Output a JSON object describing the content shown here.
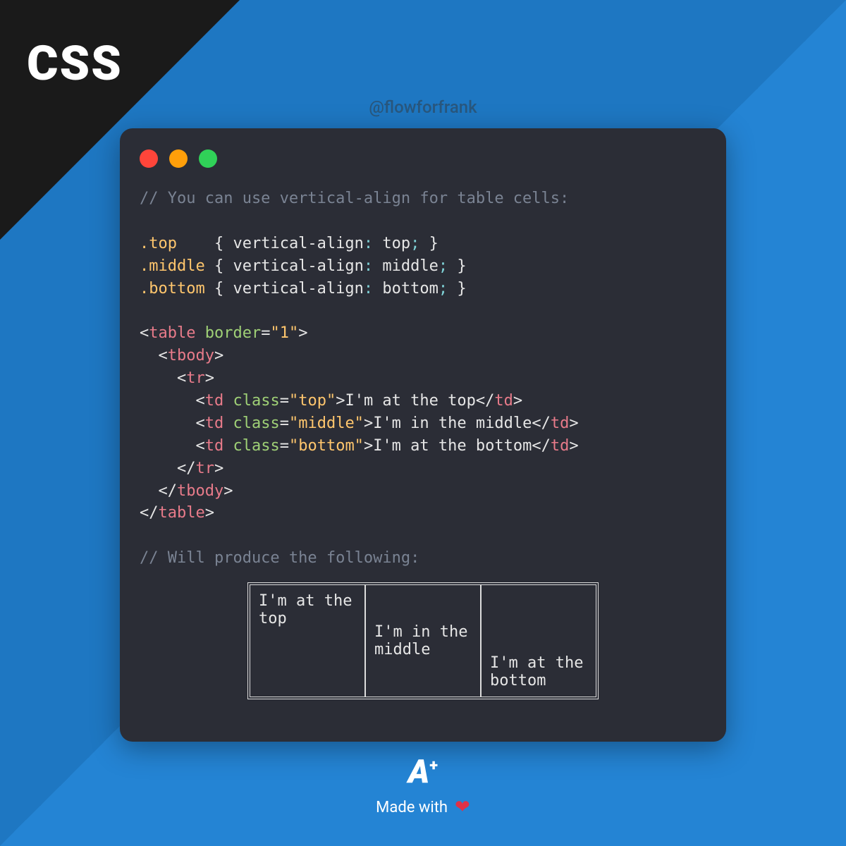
{
  "badge": "CSS",
  "handle": "@flowforfrank",
  "code": {
    "comment1": "// You can use vertical-align for table cells:",
    "sel1": ".top",
    "sel2": ".middle",
    "sel3": ".bottom",
    "prop": "vertical-align",
    "val1": "top",
    "val2": "middle",
    "val3": "bottom",
    "tag_table": "table",
    "attr_border": "border",
    "border_val": "\"1\"",
    "tag_tbody": "tbody",
    "tag_tr": "tr",
    "tag_td": "td",
    "attr_class": "class",
    "cls_top": "\"top\"",
    "cls_mid": "\"middle\"",
    "cls_bot": "\"bottom\"",
    "txt_top": "I'm at the top",
    "txt_mid": "I'm in the middle",
    "txt_bot": "I'm at the bottom",
    "comment2": "// Will produce the following:"
  },
  "demo": {
    "cell_top": "I'm at the top",
    "cell_mid": "I'm in the middle",
    "cell_bot": "I'm at the bottom"
  },
  "footer": {
    "logo_a": "A",
    "logo_plus": "+",
    "made_text": "Made with"
  }
}
